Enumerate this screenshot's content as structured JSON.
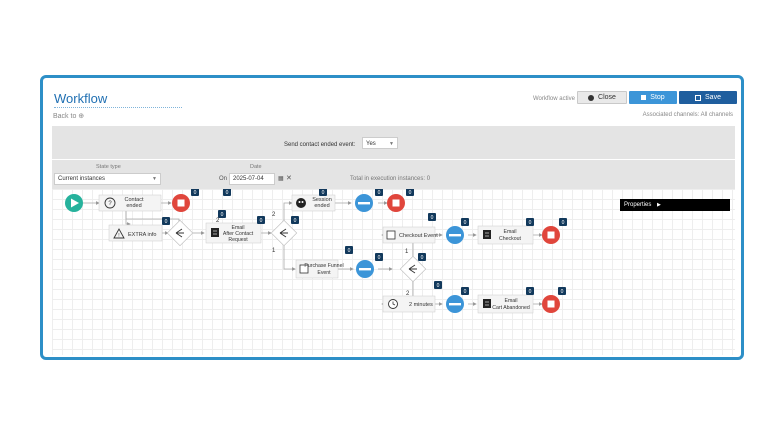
{
  "header": {
    "title": "Workflow",
    "back": "Back to ⊕",
    "workflow_active": "Workflow active",
    "close": "Close",
    "stop": "Stop",
    "save": "Save",
    "associated_channels": "Associated channels: All channels"
  },
  "send_event": {
    "label": "Send contact ended event:",
    "value": "Yes"
  },
  "filters": {
    "state_label": "State type",
    "state_value": "Current instances",
    "date_label": "Date",
    "on_label": "On",
    "date_value": "2025-07-04",
    "total": "Total in execution instances: 0"
  },
  "properties": {
    "label": "Properties"
  },
  "nodes": {
    "contact_ended": [
      "Contact",
      "ended"
    ],
    "extra_info": [
      "EXTRA info"
    ],
    "email_after": [
      "Email",
      "After Contact",
      "Request"
    ],
    "session_ended": [
      "Session",
      "ended"
    ],
    "purchase_funnel": [
      "Purchase Funnel",
      "Event"
    ],
    "checkout_event": [
      "Checkout Event"
    ],
    "email_checkout": [
      "Email",
      "Checkout"
    ],
    "two_minutes": [
      "2 minutes"
    ],
    "email_cart": [
      "Email",
      "Cart Abandoned"
    ]
  },
  "badges": {
    "zero": "0"
  },
  "edge_labels": {
    "one": "1",
    "two": "2"
  },
  "colors": {
    "accent_blue": "#3c95d8",
    "dark_blue": "#1f5e9e",
    "start_green": "#26b29c",
    "stop_red": "#e0463c",
    "badge_navy": "#12395c"
  }
}
